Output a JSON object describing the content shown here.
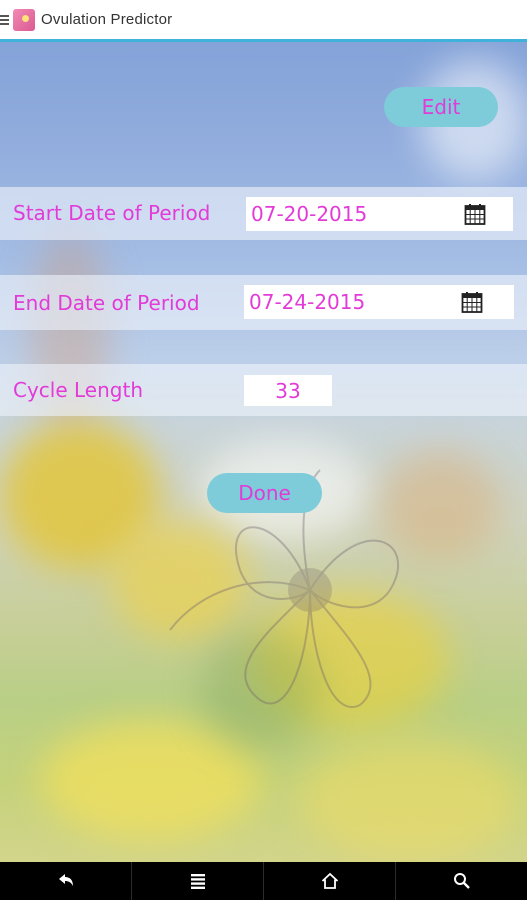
{
  "app": {
    "title": "Ovulation Predictor",
    "accent_color": "#3fb1da",
    "label_color": "#e23bd8",
    "button_color": "#7ecbda"
  },
  "toolbar": {
    "edit_label": "Edit"
  },
  "form": {
    "start_date": {
      "label": "Start Date of Period",
      "value": "07-20-2015",
      "icon": "calendar-icon"
    },
    "end_date": {
      "label": "End Date of Period",
      "value": "07-24-2015",
      "icon": "calendar-icon"
    },
    "cycle_length": {
      "label": "Cycle Length",
      "value": "33"
    },
    "done_label": "Done"
  },
  "navbar": {
    "buttons": [
      {
        "name": "back",
        "icon": "back-arrow-icon"
      },
      {
        "name": "menu",
        "icon": "menu-icon"
      },
      {
        "name": "home",
        "icon": "home-icon"
      },
      {
        "name": "search",
        "icon": "search-icon"
      }
    ]
  }
}
